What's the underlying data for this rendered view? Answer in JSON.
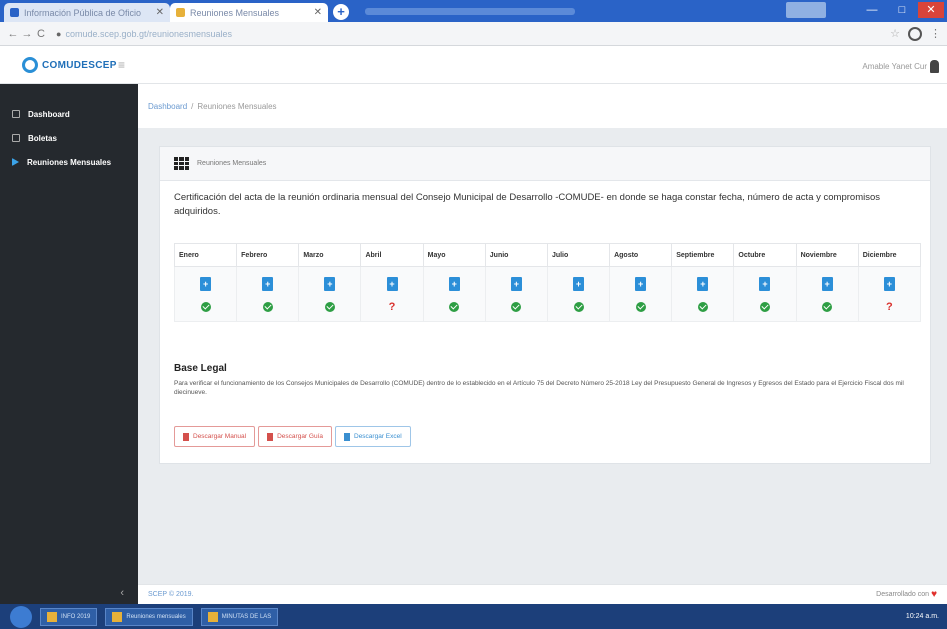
{
  "browser": {
    "tabs": [
      {
        "label": "Información Pública de Oficio",
        "favicon_color": "#2a63c7"
      },
      {
        "label": "Reuniones Mensuales",
        "favicon_color": "#e7b13a"
      }
    ],
    "new_tab": "+",
    "url": "comude.scep.gob.gt/reunionesmensuales",
    "controls": {
      "back": "←",
      "forward": "→",
      "reload": "C",
      "star": "☆",
      "menu": "⋮",
      "close": "✕",
      "min": "—",
      "max": "□"
    }
  },
  "app": {
    "logo": "COMUDESCEP",
    "menu_icon": "≡",
    "user_name": "Amable Yanet Cur"
  },
  "sidebar": {
    "items": [
      {
        "label": "Dashboard",
        "icon": "dashboard-icon"
      },
      {
        "label": "Boletas",
        "icon": "file-icon"
      },
      {
        "label": "Reuniones Mensuales",
        "icon": "caret-right-icon"
      }
    ],
    "collapse": "‹"
  },
  "breadcrumb": {
    "root": "Dashboard",
    "sep": "/",
    "current": "Reuniones Mensuales"
  },
  "card": {
    "title": "Reuniones Mensuales",
    "description": "Certificación del acta de la reunión ordinaria mensual del Consejo Municipal de Desarrollo -COMUDE- en donde se haga constar fecha, número de acta y compromisos adquiridos.",
    "months": [
      {
        "name": "Enero",
        "status": "ok"
      },
      {
        "name": "Febrero",
        "status": "ok"
      },
      {
        "name": "Marzo",
        "status": "ok"
      },
      {
        "name": "Abril",
        "status": "missing"
      },
      {
        "name": "Mayo",
        "status": "ok"
      },
      {
        "name": "Junio",
        "status": "ok"
      },
      {
        "name": "Julio",
        "status": "ok"
      },
      {
        "name": "Agosto",
        "status": "ok"
      },
      {
        "name": "Septiembre",
        "status": "ok"
      },
      {
        "name": "Octubre",
        "status": "ok"
      },
      {
        "name": "Noviembre",
        "status": "ok"
      },
      {
        "name": "Diciembre",
        "status": "missing"
      }
    ],
    "missing_symbol": "?",
    "legal_heading": "Base Legal",
    "legal_text": "Para verificar el funcionamiento de los Consejos Municipales de Desarrollo (COMUDE) dentro de lo establecido en el Artículo 75 del Decreto Número 25-2018 Ley del Presupuesto General de Ingresos y Egresos del Estado para el Ejercicio Fiscal dos mil diecinueve.",
    "buttons": [
      {
        "label": "Descargar Manual",
        "style": "red"
      },
      {
        "label": "Descargar Guía",
        "style": "red"
      },
      {
        "label": "Descargar Excel",
        "style": "blue"
      }
    ]
  },
  "footer": {
    "copyright": "SCEP © 2019.",
    "developed": "Desarrollado con",
    "heart": "♥"
  },
  "taskbar": {
    "tasks": [
      "INFO 2019",
      "Reuniones mensuales",
      "MINUTAS DE LAS"
    ],
    "time": "10:24 a.m."
  }
}
